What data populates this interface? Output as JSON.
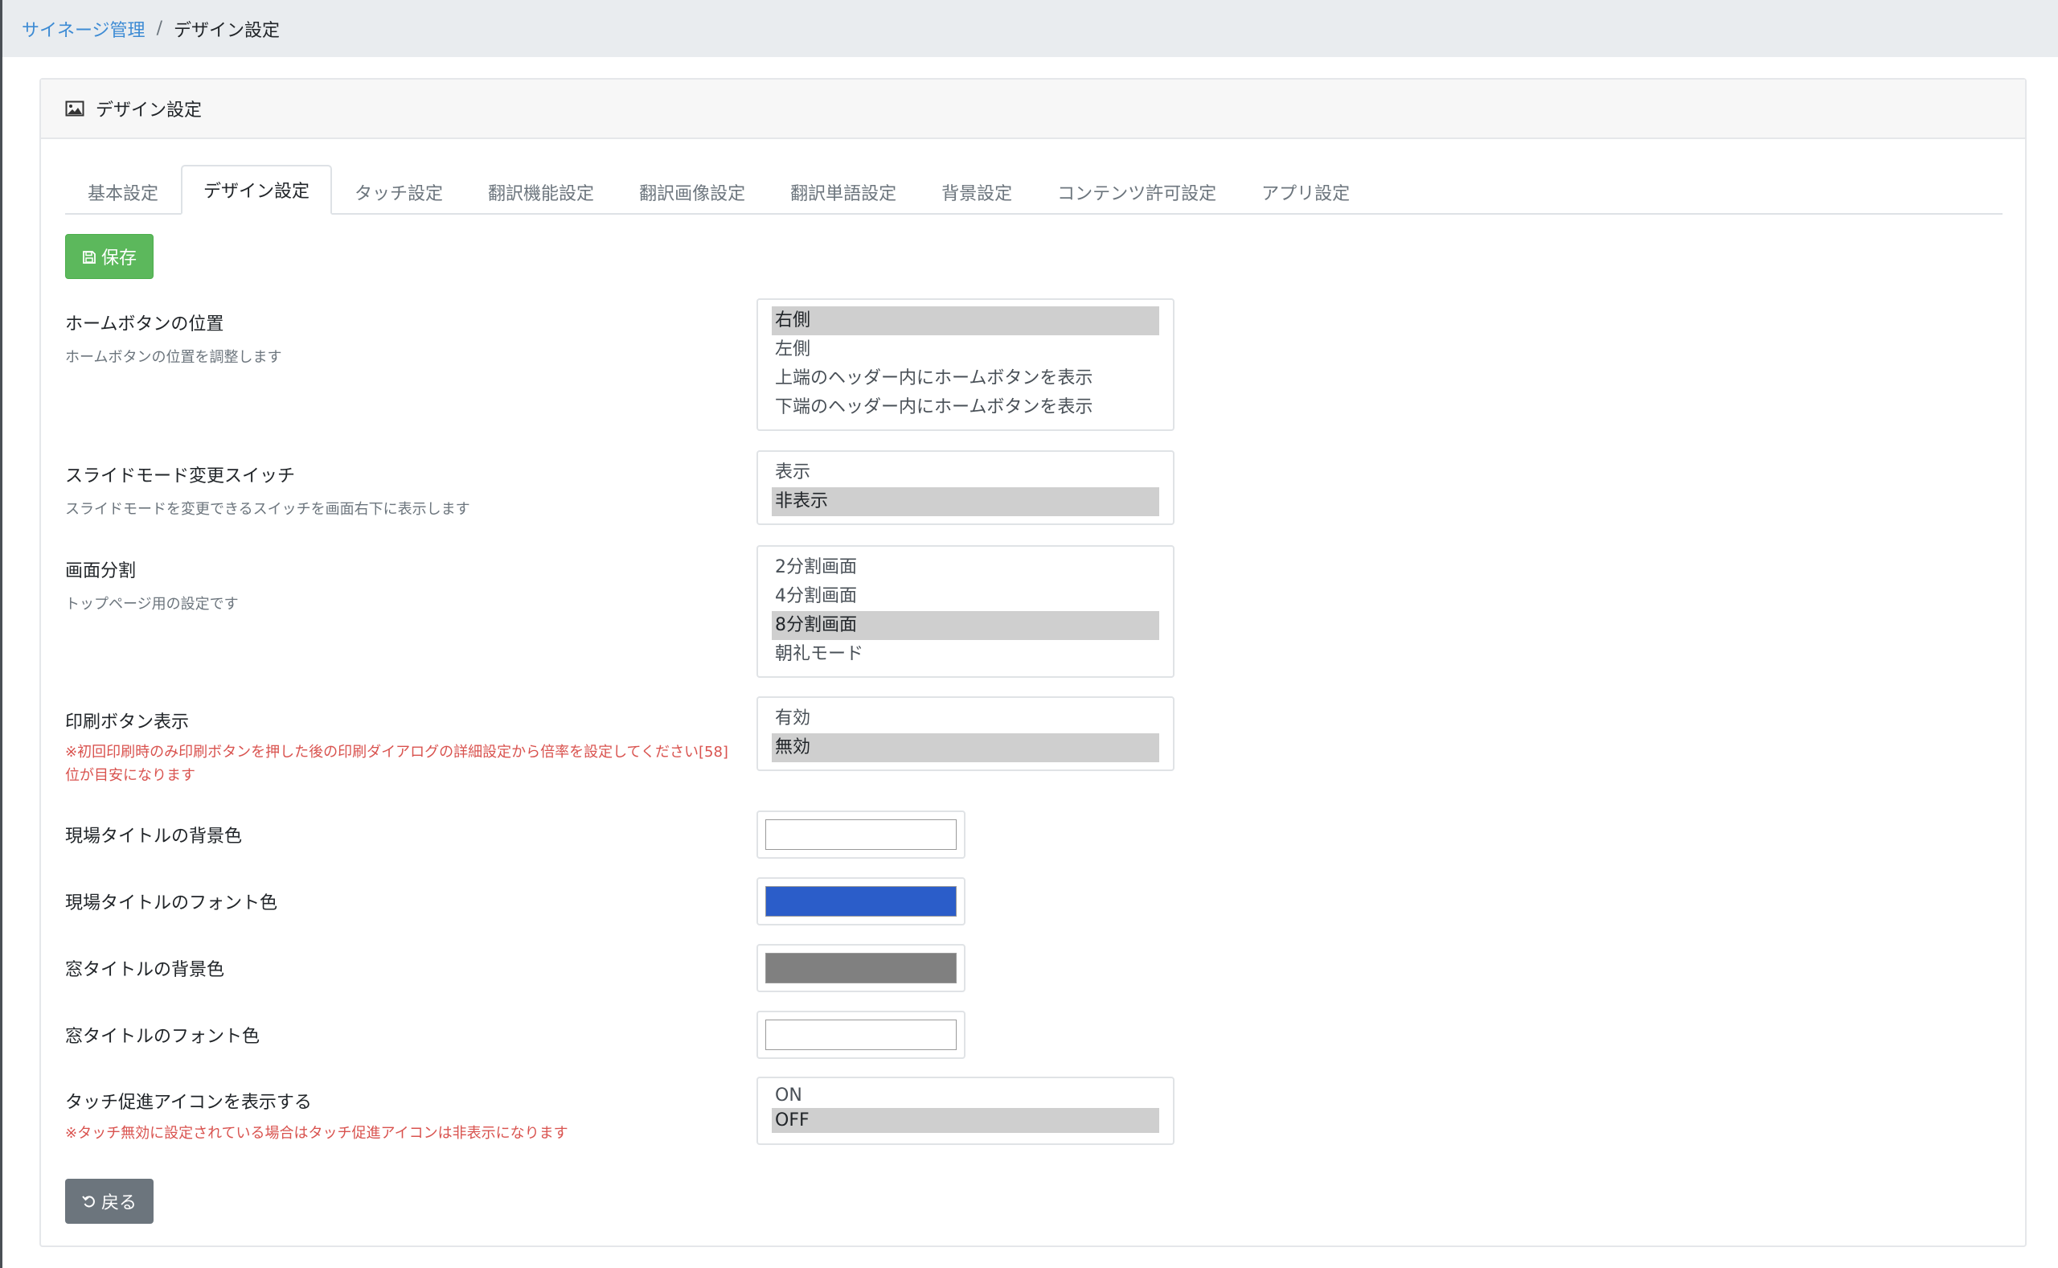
{
  "breadcrumb": {
    "parent": "サイネージ管理",
    "separator": "/",
    "current": "デザイン設定"
  },
  "card": {
    "title": "デザイン設定",
    "icon": "image-icon"
  },
  "tabs": [
    {
      "label": "基本設定",
      "active": false
    },
    {
      "label": "デザイン設定",
      "active": true
    },
    {
      "label": "タッチ設定",
      "active": false
    },
    {
      "label": "翻訳機能設定",
      "active": false
    },
    {
      "label": "翻訳画像設定",
      "active": false
    },
    {
      "label": "翻訳単語設定",
      "active": false
    },
    {
      "label": "背景設定",
      "active": false
    },
    {
      "label": "コンテンツ許可設定",
      "active": false
    },
    {
      "label": "アプリ設定",
      "active": false
    }
  ],
  "save_button": {
    "label": "保存",
    "icon": "floppy-disk-icon"
  },
  "settings": {
    "home_button": {
      "label": "ホームボタンの位置",
      "help": "ホームボタンの位置を調整します",
      "options": [
        "右側",
        "左側",
        "上端のヘッダー内にホームボタンを表示",
        "下端のヘッダー内にホームボタンを表示"
      ],
      "selected": "右側"
    },
    "slide_mode": {
      "label": "スライドモード変更スイッチ",
      "help": "スライドモードを変更できるスイッチを画面右下に表示します",
      "options": [
        "表示",
        "非表示"
      ],
      "selected": "非表示"
    },
    "screen_split": {
      "label": "画面分割",
      "help": "トップページ用の設定です",
      "options": [
        "2分割画面",
        "4分割画面",
        "8分割画面",
        "朝礼モード"
      ],
      "selected": "8分割画面"
    },
    "print_button": {
      "label": "印刷ボタン表示",
      "note": "※初回印刷時のみ印刷ボタンを押した後の印刷ダイアログの詳細設定から倍率を設定してください[58]位が目安になります",
      "options": [
        "有効",
        "無効"
      ],
      "selected": "無効"
    },
    "site_title_bg": {
      "label": "現場タイトルの背景色",
      "color": "#ffffff"
    },
    "site_title_font": {
      "label": "現場タイトルのフォント色",
      "color": "#2b5dc9"
    },
    "window_title_bg": {
      "label": "窓タイトルの背景色",
      "color": "#808080"
    },
    "window_title_font": {
      "label": "窓タイトルのフォント色",
      "color": "#ffffff"
    },
    "touch_icon": {
      "label": "タッチ促進アイコンを表示する",
      "note": "※タッチ無効に設定されている場合はタッチ促進アイコンは非表示になります",
      "options": [
        "ON",
        "OFF"
      ],
      "selected": "OFF"
    }
  },
  "back_button": {
    "label": "戻る",
    "icon": "undo-icon"
  },
  "colors": {
    "link": "#3d8bd4",
    "success": "#5cb85c",
    "secondary": "#6c757d",
    "danger": "#d9534f"
  }
}
